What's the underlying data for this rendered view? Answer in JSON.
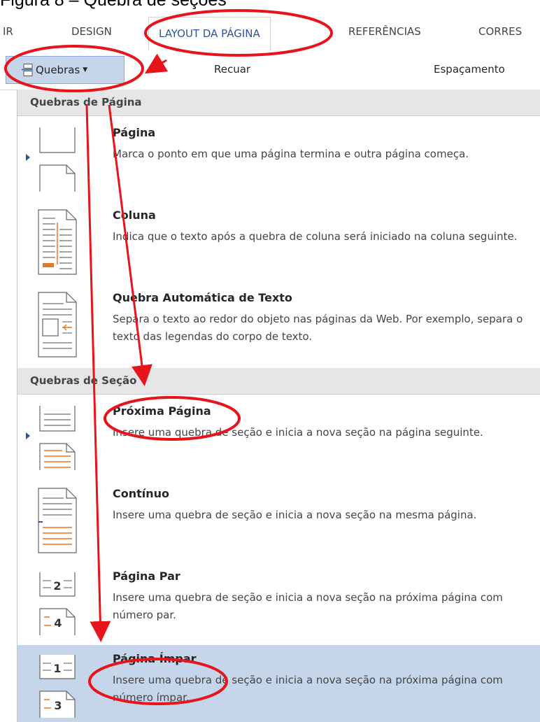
{
  "caption": "Figura 8 – Quebra de seções",
  "ribbon": {
    "tabs": [
      "IR",
      "DESIGN",
      "LAYOUT DA PÁGINA",
      "REFERÊNCIAS",
      "CORRES"
    ],
    "breaks_button": "Quebras",
    "indent_label": "Recuar",
    "spacing_label": "Espaçamento"
  },
  "menu": {
    "page_breaks_header": "Quebras de Página",
    "section_breaks_header": "Quebras de Seção",
    "items": [
      {
        "title": "Página",
        "description": "Marca o ponto em que uma página termina e outra página começa."
      },
      {
        "title": "Coluna",
        "description": "Indica que o texto após a quebra de coluna será iniciado na coluna seguinte."
      },
      {
        "title": "Quebra Automática de Texto",
        "description": "Separa o texto ao redor do objeto nas páginas da Web. Por exemplo, separa o texto das legendas do corpo de texto."
      },
      {
        "title": "Próxima Página",
        "description": "Insere uma quebra de seção e inicia a nova seção na página seguinte."
      },
      {
        "title": "Contínuo",
        "description": "Insere uma quebra de seção e inicia a nova seção na mesma página."
      },
      {
        "title": "Página Par",
        "description": "Insere uma quebra de seção e inicia a nova seção na próxima página com número par."
      },
      {
        "title": "Página Ímpar",
        "description": "Insere uma quebra de seção e inicia a nova seção na próxima página com número ímpar."
      }
    ],
    "icon_numbers": {
      "even_top": "2",
      "even_bottom": "4",
      "odd_top": "1",
      "odd_bottom": "3"
    }
  },
  "colors": {
    "accent": "#2b579a",
    "highlight": "#c5d5ea",
    "annotation": "#e8141b",
    "icon_orange": "#e87722"
  }
}
